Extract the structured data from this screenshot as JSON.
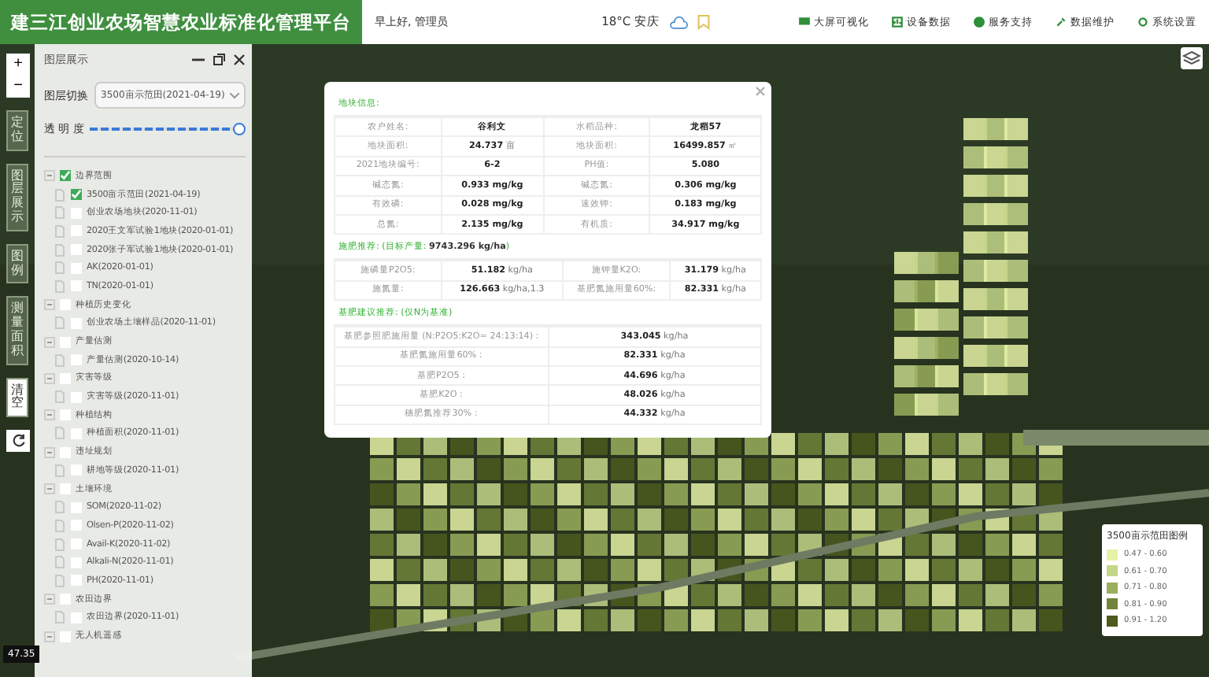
{
  "header": {
    "title": "建三江创业农场智慧农业标准化管理平台",
    "greeting": "早上好, 管理员",
    "weather": "18°C 安庆",
    "nav": [
      {
        "label": "大屏可视化"
      },
      {
        "label": "设备数据"
      },
      {
        "label": "服务支持"
      },
      {
        "label": "数据维护"
      },
      {
        "label": "系统设置"
      }
    ]
  },
  "map_tools": {
    "zoom_in": "+",
    "zoom_out": "−",
    "buttons": [
      "定位",
      "图层展示",
      "图例",
      "测量面积",
      "清空"
    ]
  },
  "layer_panel": {
    "title": "图层展示",
    "switch_label": "图层切换",
    "switch_value": "3500亩示范田(2021-04-19)",
    "opacity_label": "透 明 度",
    "opacity": {
      "level": 1.0
    },
    "tree": [
      {
        "label": "边界范围",
        "checked": true,
        "children": [
          {
            "label": "3500亩示范田(2021-04-19)",
            "checked": true
          },
          {
            "label": "创业农场地块(2020-11-01)",
            "checked": false
          },
          {
            "label": "2020王文军试验1地块(2020-01-01)",
            "checked": false
          },
          {
            "label": "2020张子军试验1地块(2020-01-01)",
            "checked": false
          },
          {
            "label": "AK(2020-01-01)",
            "checked": false
          },
          {
            "label": "TN(2020-01-01)",
            "checked": false
          }
        ]
      },
      {
        "label": "种植历史变化",
        "checked": false,
        "children": [
          {
            "label": "创业农场土壤样品(2020-11-01)",
            "checked": false
          }
        ]
      },
      {
        "label": "产量估测",
        "checked": false,
        "children": [
          {
            "label": "产量估测(2020-10-14)",
            "checked": false
          }
        ]
      },
      {
        "label": "灾害等级",
        "checked": false,
        "children": [
          {
            "label": "灾害等级(2020-11-01)",
            "checked": false
          }
        ]
      },
      {
        "label": "种植结构",
        "checked": false,
        "children": [
          {
            "label": "种植面积(2020-11-01)",
            "checked": false
          }
        ]
      },
      {
        "label": "违址规划",
        "checked": false,
        "children": [
          {
            "label": "耕地等级(2020-11-01)",
            "checked": false
          }
        ]
      },
      {
        "label": "土壤环境",
        "checked": false,
        "children": [
          {
            "label": "SOM(2020-11-02)",
            "checked": false
          },
          {
            "label": "Olsen-P(2020-11-02)",
            "checked": false
          },
          {
            "label": "Avail-K(2020-11-02)",
            "checked": false
          },
          {
            "label": "Alkali-N(2020-11-01)",
            "checked": false
          },
          {
            "label": "PH(2020-11-01)",
            "checked": false
          }
        ]
      },
      {
        "label": "农田边界",
        "checked": false,
        "children": [
          {
            "label": "农田边界(2020-11-01)",
            "checked": false
          }
        ]
      },
      {
        "label": "无人机遥感",
        "checked": false
      }
    ]
  },
  "coordinate": "47.35",
  "popup": {
    "section_1": {
      "title": "地块信息:",
      "rows": [
        [
          "农户姓名:",
          "**谷利文**",
          "水稻品种:",
          "**龙稻57**"
        ],
        [
          "地块面积:",
          "**24.737** 亩",
          "地块面积:",
          "**16499.857** ㎡"
        ],
        [
          "2021地块编号:",
          "**6-2**",
          "PH值:",
          "**5.080**"
        ],
        [
          "碱态氮:",
          "**0.933 mg/kg**",
          "碱态氮:",
          "**0.306 mg/kg**"
        ],
        [
          "有效磷:",
          "**0.028 mg/kg**",
          "速效钾:",
          "**0.183 mg/kg**"
        ],
        [
          "总氮:",
          "**2.135 mg/kg**",
          "有机质:",
          "**34.917 mg/kg**"
        ]
      ]
    },
    "section_2": {
      "title": "施肥推荐: (目标产量: **9743.296 kg/ha**)",
      "rows": [
        [
          "施磷量P2O5:",
          "**51.182** kg/ha",
          "施钾量K2O:",
          "**31.179** kg/ha"
        ],
        [
          "施氮量:",
          "**126.663** kg/ha,1.3",
          "基肥氮施用量60%:",
          "**82.331** kg/ha"
        ]
      ]
    },
    "section_3": {
      "title": "基肥建议推荐: (仅N为基准)",
      "rows": [
        [
          "基肥参照肥施用量 (N:P2O5:K2O= 24:13:14) :",
          "**343.045** kg/ha"
        ],
        [
          "基肥氮施用量60% :",
          "**82.331** kg/ha"
        ],
        [
          "基肥P2O5 :",
          "**44.696** kg/ha"
        ],
        [
          "基肥K2O :",
          "**48.026** kg/ha"
        ],
        [
          "穗肥氮推荐30% :",
          "**44.332** kg/ha"
        ]
      ]
    }
  },
  "legend": {
    "title": "3500亩示范田图例",
    "items": [
      {
        "label": "0.47 - 0.60",
        "color": "#e6f2a6"
      },
      {
        "label": "0.61 - 0.70",
        "color": "#c4d68a"
      },
      {
        "label": "0.71 - 0.80",
        "color": "#9aae5c"
      },
      {
        "label": "0.81 - 0.90",
        "color": "#71843a"
      },
      {
        "label": "0.91 - 1.20",
        "color": "#4c5a1e"
      }
    ]
  }
}
